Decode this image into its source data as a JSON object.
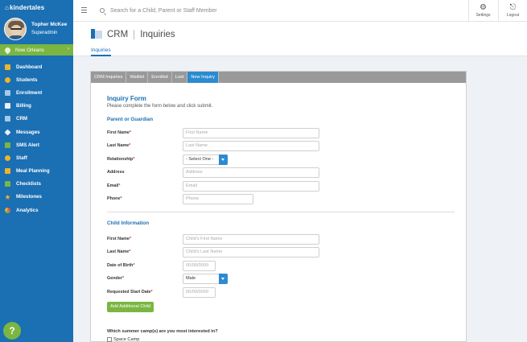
{
  "app": {
    "logo_glyph": "⌂",
    "logo_text": "kindertales"
  },
  "profile": {
    "name": "Topher McKee",
    "role": "Superadmin"
  },
  "location": {
    "name": "New Orleans",
    "chevron": "›"
  },
  "sidebar": {
    "items": [
      {
        "label": "Dashboard",
        "icon": "dashboard-icon",
        "color": "#f0b429"
      },
      {
        "label": "Students",
        "icon": "students-icon",
        "color": "#f0b429"
      },
      {
        "label": "Enrollment",
        "icon": "enrollment-icon",
        "color": "#a8c8e8"
      },
      {
        "label": "Billing",
        "icon": "billing-icon",
        "color": "#e8f0f8"
      },
      {
        "label": "CRM",
        "icon": "crm-icon",
        "color": "#a8c8e8"
      },
      {
        "label": "Messages",
        "icon": "messages-icon",
        "color": "#e8f0f8"
      },
      {
        "label": "SMS Alert",
        "icon": "sms-icon",
        "color": "#7ab641"
      },
      {
        "label": "Staff",
        "icon": "staff-icon",
        "color": "#f0b429"
      },
      {
        "label": "Meal Planning",
        "icon": "meal-icon",
        "color": "#f0b429"
      },
      {
        "label": "Checklists",
        "icon": "checklist-icon",
        "color": "#7ab641"
      },
      {
        "label": "Milestones",
        "icon": "milestones-icon",
        "color": "#f0b429"
      },
      {
        "label": "Analytics",
        "icon": "analytics-icon",
        "color": "#e05a5a"
      }
    ],
    "help_label": "?"
  },
  "topbar": {
    "search_placeholder": "Search for a Child, Parent or Staff Member",
    "settings_label": "Settings",
    "logout_label": "Logout",
    "settings_glyph": "⚙",
    "logout_glyph": "⎋"
  },
  "page": {
    "module": "CRM",
    "title": "Inquiries",
    "subtab": "Inquiries"
  },
  "tabs": [
    "CRM Inquiries",
    "Waitlist",
    "Enrolled",
    "Lost",
    "New Inquiry"
  ],
  "form": {
    "title": "Inquiry Form",
    "subtitle": "Please complete the form below and click submit.",
    "parent_section": "Parent or Guardian",
    "parent_fields": {
      "first_name": {
        "label": "First Name",
        "placeholder": "First Name"
      },
      "last_name": {
        "label": "Last Name",
        "placeholder": "Last Name"
      },
      "relationship": {
        "label": "Relationship",
        "value": "- Select One -"
      },
      "address": {
        "label": "Address",
        "placeholder": "Address"
      },
      "email": {
        "label": "Email",
        "placeholder": "Email"
      },
      "phone": {
        "label": "Phone",
        "placeholder": "Phone"
      }
    },
    "child_section": "Child Information",
    "child_fields": {
      "first_name": {
        "label": "First Name",
        "placeholder": "Child's First Name"
      },
      "last_name": {
        "label": "Last Name",
        "placeholder": "Child's Last Name"
      },
      "dob": {
        "label": "Date of Birth",
        "placeholder": "00/00/0000"
      },
      "gender": {
        "label": "Gender",
        "value": "Male"
      },
      "start_date": {
        "label": "Requested Start Date",
        "placeholder": "00/00/0000"
      }
    },
    "add_child_label": "Add Additional Child",
    "camp_question": "Which summer camp(s) are you most interested in?",
    "camp_options": [
      "Space Camp"
    ],
    "required_mark": "*"
  },
  "colors": {
    "sidebar": "#1b6fb3",
    "accent_green": "#7ab641",
    "accent_blue": "#2b8bd0"
  }
}
